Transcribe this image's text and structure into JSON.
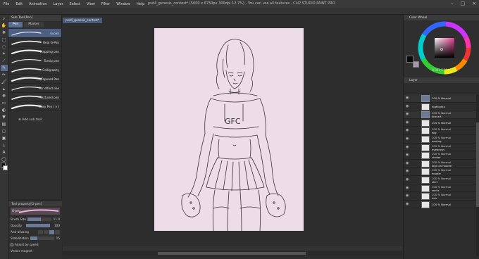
{
  "menu": [
    "File",
    "Edit",
    "Animation",
    "Layer",
    "Select",
    "View",
    "Filter",
    "Window",
    "Help"
  ],
  "window_title": "psd4_genesis_contest* (5000 x 6750px 300dpi 12.7%) - You can use all features - CLIP STUDIO PAINT PRO",
  "subtool": {
    "title": "Sub Tool[Pen]",
    "tabs": [
      "Pen",
      "Marker"
    ],
    "brushes": [
      {
        "label": "G-pen",
        "active": true
      },
      {
        "label": "Real G-Pen",
        "active": false
      },
      {
        "label": "Mapping pen",
        "active": false
      },
      {
        "label": "Turnip pen",
        "active": false
      },
      {
        "label": "Calligraphy",
        "active": false
      },
      {
        "label": "Tapered Pen",
        "active": false
      },
      {
        "label": "For effect line",
        "active": false
      },
      {
        "label": "Textured pen",
        "active": false
      },
      {
        "label": "Easy Pen ( v )",
        "active": false
      }
    ],
    "add_label": "Add sub tool"
  },
  "tool_property": {
    "title": "Tool property[G-pen]",
    "preview_label": "G-pen",
    "brush_size_label": "Brush Size",
    "brush_size_value": "11.0",
    "brush_size_fill": 0.55,
    "opacity_label": "Opacity",
    "opacity_value": "100",
    "opacity_fill": 1.0,
    "antialias_label": "Anti-aliasing",
    "stabilization_label": "Stabilization",
    "stabilization_value": "15",
    "stabilization_fill": 0.3,
    "adjust_speed_label": "Adjust by speed",
    "vector_label": "Vector magnet"
  },
  "document": {
    "tab_label": "psd4_genesis_contest*",
    "paper_color": "#ecdde9"
  },
  "color_panel": {
    "title": "Color Wheel",
    "readout": "H 341  S 30  V 44",
    "main_color": "#0a0a0a",
    "sub_color": "#a895a8"
  },
  "layer_panel": {
    "title": "Layer",
    "layers": [
      {
        "name": "100 % Normal",
        "mode": "",
        "folder": true
      },
      {
        "name": "highlights",
        "mode": "",
        "folder": false
      },
      {
        "name": "line art",
        "mode": "100 % Normal",
        "folder": true
      },
      {
        "name": "100 % Normal",
        "mode": "",
        "folder": false
      },
      {
        "name": "wig",
        "mode": "100 % Normal",
        "folder": false
      },
      {
        "name": "earring",
        "mode": "100 % Normal",
        "folder": false
      },
      {
        "name": "eyebrows",
        "mode": "100 % Normal",
        "folder": false
      },
      {
        "name": "choker",
        "mode": "100 % Normal",
        "folder": false
      },
      {
        "name": "logo on hoodie",
        "mode": "100 % Normal",
        "folder": false
      },
      {
        "name": "hoodie",
        "mode": "100 % Normal",
        "folder": false
      },
      {
        "name": "skirt",
        "mode": "100 % Normal",
        "folder": false
      },
      {
        "name": "socks",
        "mode": "100 % Normal",
        "folder": false
      },
      {
        "name": "hair",
        "mode": "100 % Normal",
        "folder": false
      },
      {
        "name": "100 % Normal",
        "mode": "",
        "folder": false
      }
    ]
  }
}
